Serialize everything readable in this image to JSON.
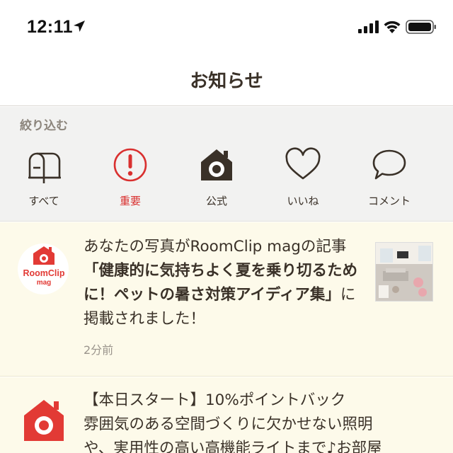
{
  "status": {
    "time": "12:11"
  },
  "nav": {
    "title": "お知らせ"
  },
  "filter": {
    "label": "絞り込む",
    "items": [
      {
        "label": "すべて",
        "icon": "mailbox-icon"
      },
      {
        "label": "重要",
        "icon": "exclamation-icon",
        "color": "#d9302f"
      },
      {
        "label": "公式",
        "icon": "camera-house-icon"
      },
      {
        "label": "いいね",
        "icon": "heart-icon"
      },
      {
        "label": "コメント",
        "icon": "speech-bubble-icon"
      }
    ]
  },
  "notices": [
    {
      "logo": {
        "line1": "RoomClip",
        "line2": "mag"
      },
      "text_pre": "あなたの写真がRoomClip magの記事",
      "text_bold": "「健康的に気持ちよく夏を乗り切るために！ペットの暑さ対策アイディア集」",
      "text_post": "に掲載されました！",
      "time": "2分前"
    },
    {
      "line1": "【本日スタート】10%ポイントバック",
      "line2": "雰囲気のある空間づくりに欠かせない照明",
      "line3": "や、実用性の高い高機能ライトまで♪お部屋"
    }
  ],
  "colors": {
    "accent": "#d9302f",
    "brown": "#3a3128",
    "notice_bg": "#fdfaea"
  }
}
